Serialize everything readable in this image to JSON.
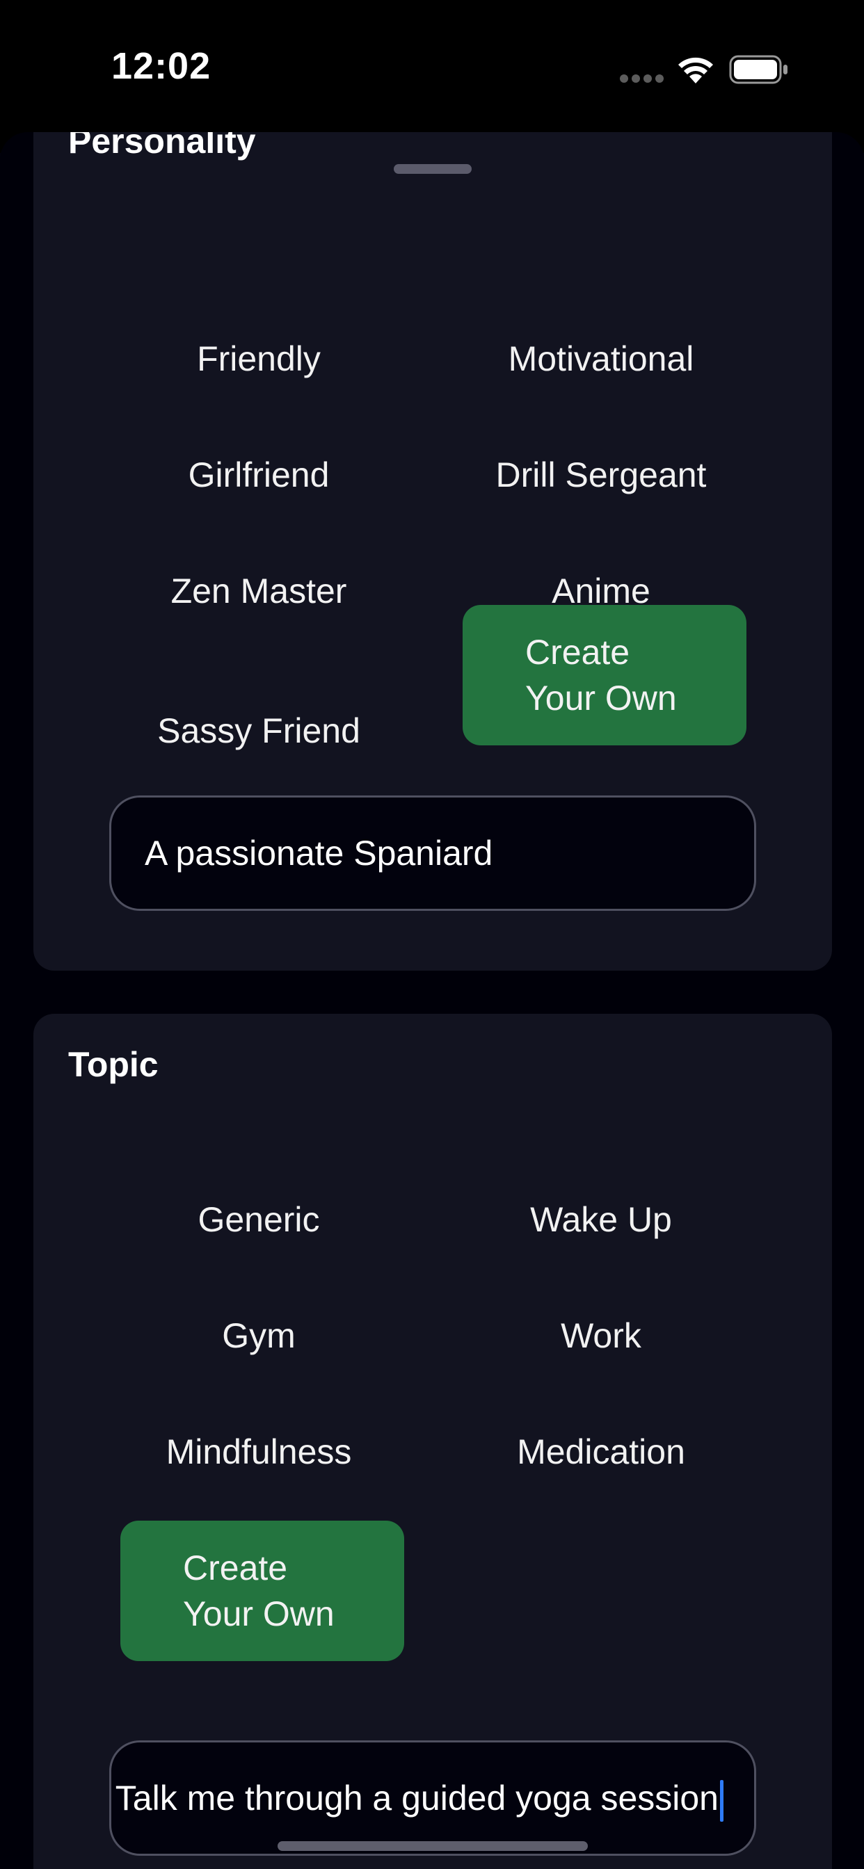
{
  "status_bar": {
    "time": "12:02",
    "signal_icon": "cellular-signal-icon",
    "wifi_icon": "wifi-icon",
    "battery_icon": "battery-icon"
  },
  "colors": {
    "selected_option": "#23743f",
    "card_background": "#121320",
    "caret": "#2f7bf6"
  },
  "personality": {
    "title": "Personality",
    "options": [
      {
        "label": "Friendly",
        "selected": false
      },
      {
        "label": "Motivational",
        "selected": false
      },
      {
        "label": "Girlfriend",
        "selected": false
      },
      {
        "label": "Drill Sergeant",
        "selected": false
      },
      {
        "label": "Zen Master",
        "selected": false
      },
      {
        "label": "Anime",
        "selected": false
      },
      {
        "label": "Sassy Friend",
        "selected": false
      },
      {
        "label": "Create Your Own",
        "line1": "Create",
        "line2": "Your Own",
        "selected": true
      }
    ],
    "custom_input": {
      "value": "A passionate Spaniard"
    }
  },
  "topic": {
    "title": "Topic",
    "options": [
      {
        "label": "Generic",
        "selected": false
      },
      {
        "label": "Wake Up",
        "selected": false
      },
      {
        "label": "Gym",
        "selected": false
      },
      {
        "label": "Work",
        "selected": false
      },
      {
        "label": "Mindfulness",
        "selected": false
      },
      {
        "label": "Medication",
        "selected": false
      },
      {
        "label": "Create Your Own",
        "line1": "Create",
        "line2": "Your Own",
        "selected": true
      }
    ],
    "custom_input": {
      "value": "Talk me through a guided yoga session"
    }
  }
}
